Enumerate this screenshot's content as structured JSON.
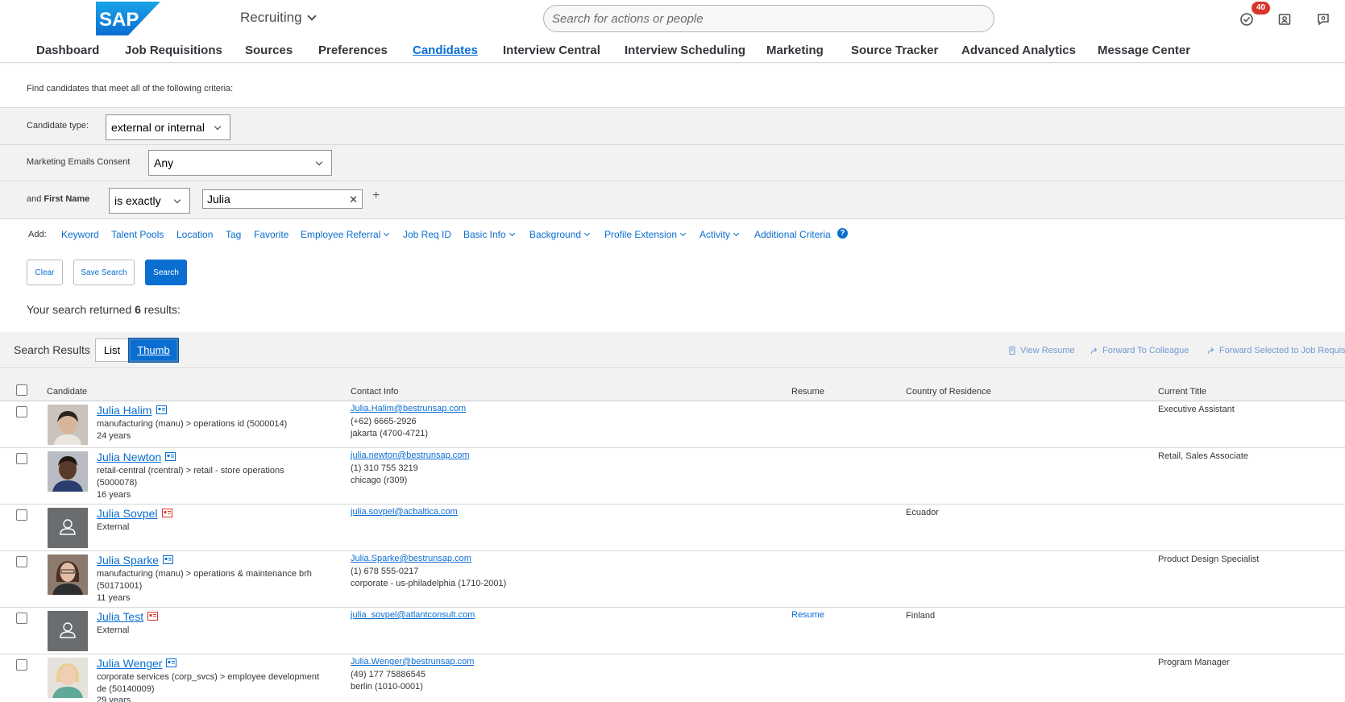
{
  "header": {
    "module": "Recruiting",
    "search_placeholder": "Search for actions or people",
    "notification_count": "40"
  },
  "nav": [
    {
      "label": "Dashboard",
      "active": false
    },
    {
      "label": "Job Requisitions",
      "active": false
    },
    {
      "label": "Sources",
      "active": false
    },
    {
      "label": "Preferences",
      "active": false
    },
    {
      "label": "Candidates",
      "active": true
    },
    {
      "label": "Interview Central",
      "active": false
    },
    {
      "label": "Interview Scheduling",
      "active": false
    },
    {
      "label": "Marketing",
      "active": false
    },
    {
      "label": "Source Tracker",
      "active": false
    },
    {
      "label": "Advanced Analytics",
      "active": false
    },
    {
      "label": "Message Center",
      "active": false
    }
  ],
  "search_panel": {
    "criteria_text": "Find candidates that meet all of the following criteria:",
    "candidate_type_label": "Candidate type:",
    "candidate_type_value": "external or internal",
    "marketing_label": "Marketing Emails Consent",
    "marketing_value": "Any",
    "first_name_prefix": "and ",
    "first_name_label": "First Name",
    "operator_value": "is exactly",
    "first_name_value": "Julia",
    "add_label": "Add:",
    "add_links": [
      {
        "label": "Keyword",
        "dropdown": false
      },
      {
        "label": "Talent Pools",
        "dropdown": false
      },
      {
        "label": "Location",
        "dropdown": false
      },
      {
        "label": "Tag",
        "dropdown": false
      },
      {
        "label": "Favorite",
        "dropdown": false
      },
      {
        "label": "Employee Referral",
        "dropdown": true
      },
      {
        "label": "Job Req ID",
        "dropdown": false
      },
      {
        "label": "Basic Info",
        "dropdown": true
      },
      {
        "label": "Background",
        "dropdown": true
      },
      {
        "label": "Profile Extension",
        "dropdown": true
      },
      {
        "label": "Activity",
        "dropdown": true
      },
      {
        "label": "Additional Criteria",
        "dropdown": false
      }
    ],
    "clear_label": "Clear",
    "save_label": "Save Search",
    "search_label": "Search",
    "results_prefix": "Your search returned ",
    "results_count": "6",
    "results_suffix": " results:"
  },
  "results": {
    "title": "Search Results",
    "list_label": "List",
    "thumb_label": "Thumb",
    "actions": [
      "View Resume",
      "Forward To Colleague",
      "Forward Selected to Job Requis"
    ],
    "columns": [
      "Candidate",
      "Contact Info",
      "Resume",
      "Country of Residence",
      "Current Title"
    ],
    "rows": [
      {
        "name": "Julia Halim",
        "type": "internal",
        "line1": "manufacturing (manu) > operations id (5000014)",
        "line2": "24 years",
        "line3": "",
        "email": "Julia.Halim@bestrunsap.com",
        "phone": "(+62) 6665-2926",
        "location": "jakarta (4700-4721)",
        "resume": "",
        "country": "",
        "title": "Executive Assistant"
      },
      {
        "name": "Julia Newton",
        "type": "internal",
        "line1": "retail-central (rcentral) > retail - store operations",
        "line2": "(5000078)",
        "line3": "16 years",
        "email": "julia.newton@bestrunsap.com",
        "phone": "(1) 310 755 3219",
        "location": "chicago (r309)",
        "resume": "",
        "country": "",
        "title": "Retail, Sales Associate"
      },
      {
        "name": "Julia Sovpel",
        "type": "external",
        "line1": "External",
        "line2": "",
        "line3": "",
        "email": "julia.sovpel@acbaltica.com",
        "phone": "",
        "location": "",
        "resume": "",
        "country": "Ecuador",
        "title": ""
      },
      {
        "name": "Julia Sparke",
        "type": "internal",
        "line1": "manufacturing (manu) > operations & maintenance brh",
        "line2": "(50171001)",
        "line3": "11 years",
        "email": "Julia.Sparke@bestrunsap.com",
        "phone": "(1) 678 555-0217",
        "location": "corporate - us-philadelphia (1710-2001)",
        "resume": "",
        "country": "",
        "title": "Product Design Specialist"
      },
      {
        "name": "Julia Test",
        "type": "external",
        "line1": "External",
        "line2": "",
        "line3": "",
        "email": "julia_sovpel@atlantconsult.com",
        "phone": "",
        "location": "",
        "resume": "Resume",
        "country": "Finland",
        "title": ""
      },
      {
        "name": "Julia Wenger",
        "type": "internal",
        "line1": "corporate services (corp_svcs) > employee development",
        "line2": "de (50140009)",
        "line3": "29 years",
        "email": "Julia.Wenger@bestrunsap.com",
        "phone": "(49) 177 75886545",
        "location": "berlin (1010-0001)",
        "resume": "",
        "country": "",
        "title": "Program Manager"
      }
    ]
  },
  "colors": {
    "accent": "#0a6ed1",
    "external_icon": "#d9342b",
    "badge": "#d9342b"
  }
}
